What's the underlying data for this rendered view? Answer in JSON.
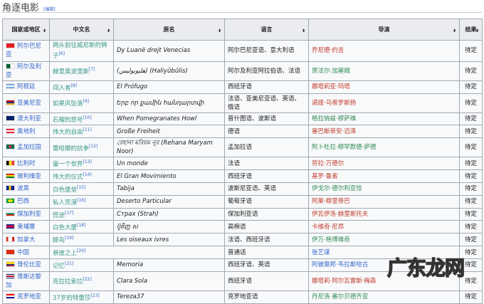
{
  "section": {
    "title": "角逐电影",
    "edit": "[编辑]"
  },
  "columns": [
    "国家或地区",
    "中文名",
    "原名",
    "语言",
    "导演",
    "结果"
  ],
  "rows": [
    {
      "country": "阿尔巴尼亚",
      "flag": "#e41e20",
      "cn": "两头前往威尼斯的狮子",
      "ref": "[6]",
      "orig": "Dy Luanë drejt Venecias",
      "lang": "阿尔巴尼亚语、意大利语",
      "dir": "乔尼德·约吉",
      "dc": "r",
      "result": "待定"
    },
    {
      "country": "阿尔及利亚",
      "flag": "linear-gradient(90deg,#006233 50%,#fff 50%)",
      "cn": "赫里奥波里斯",
      "ref": "[7]",
      "orig": "(هليوبوليس) (Haliyûbûlis)",
      "lang": "阿尔及利亚阿拉伯语、法语",
      "dir": "贾法尔·加塞姆",
      "dc": "g",
      "result": "待定"
    },
    {
      "country": "阿根廷",
      "flag": "linear-gradient(#74acdf 33%,#fff 33% 66%,#74acdf 66%)",
      "cn": "闯入者",
      "ref": "[8]",
      "orig": "El Prófugo",
      "lang": "西班牙语",
      "dir": "娜塔莉亚·玛塔",
      "dc": "r",
      "result": "待定"
    },
    {
      "country": "亚美尼亚",
      "flag": "linear-gradient(#d90012 33%,#0033a0 33% 66%,#f2a800 66%)",
      "cn": "如果风坠落",
      "ref": "[9]",
      "orig": "Երբ որ քամին հանդարտվի",
      "lang": "法语、亚美尼亚语、英语、俄语",
      "dir": "诺娅·马蒂罗斯扬",
      "dc": "r",
      "result": "待定"
    },
    {
      "country": "澳大利亚",
      "flag": "#012169",
      "cn": "石榴的怒号",
      "ref": "[10]",
      "orig": "When Pomegranates Howl",
      "lang": "普什图语、波斯语",
      "dir": "格拉纳兹·穆萨维",
      "dc": "g",
      "result": "待定"
    },
    {
      "country": "奥地利",
      "flag": "linear-gradient(#ed2939 33%,#fff 33% 66%,#ed2939 66%)",
      "cn": "伟大的自由",
      "ref": "[11]",
      "orig": "Große Freiheit",
      "lang": "德语",
      "dir": "塞巴斯蒂安·迈泽",
      "dc": "r",
      "result": "待定"
    },
    {
      "country": "孟加拉国",
      "flag": "radial-gradient(circle at 45% 50%,#f42a41 28%,#006a4e 30%)",
      "cn": "蕾哈娜的抗争",
      "ref": "[12]",
      "orig": "রেহানা মরিয়ম নূর (Rehana Maryam Noor)",
      "lang": "孟加拉语",
      "dir": "阿卜杜拉·穆罕默德·萨德",
      "dc": "g",
      "result": "待定"
    },
    {
      "country": "比利时",
      "flag": "linear-gradient(90deg,#000 33%,#fdda24 33% 66%,#ef3340 66%)",
      "cn": "童一个世界",
      "ref": "[13]",
      "orig": "Un monde",
      "lang": "法语",
      "dir": "劳拉·万德尔",
      "dc": "r",
      "result": "待定"
    },
    {
      "country": "玻利维亚",
      "flag": "linear-gradient(#d52b1e 33%,#f9e300 33% 66%,#007934 66%)",
      "cn": "伟大的仪式",
      "ref": "[14]",
      "orig": "El Gran Movimiento",
      "lang": "西班牙语",
      "dir": "基罗·鲁索",
      "dc": "r",
      "result": "待定"
    },
    {
      "country": "波黑",
      "flag": "linear-gradient(90deg,#002395 30%,#fecb00 30% 60%,#002395 60%)",
      "cn": "白色堡垒",
      "ref": "[15]",
      "orig": "Tabija",
      "lang": "波斯尼亚语、英语",
      "dir": "伊戈尔·德尔利亚恰",
      "dc": "g",
      "result": "待定"
    },
    {
      "country": "巴西",
      "flag": "radial-gradient(ellipse,#fedf00 45%,#009c3b 47%)",
      "cn": "私人荒漠",
      "ref": "[16]",
      "orig": "Deserto Particular",
      "lang": "葡萄牙语",
      "dir": "阿莱·穆里蒂巴",
      "dc": "r",
      "result": "待定"
    },
    {
      "country": "保加利亚",
      "flag": "linear-gradient(#fff 33%,#00966e 33% 66%,#d62612 66%)",
      "cn": "慌途",
      "ref": "[17]",
      "orig": "Страх (Strah)",
      "lang": "保加利亚语",
      "dir": "伊瓦伊洛·赫里斯托夫",
      "dc": "r",
      "result": "待定"
    },
    {
      "country": "柬埔寨",
      "flag": "linear-gradient(#032ea1 25%,#e00025 25% 75%,#032ea1 75%)",
      "cn": "白色大厦",
      "ref": "[18]",
      "orig": "ប៊ូតិញ ស",
      "lang": "高棉语",
      "dir": "卡维奇·尼昂",
      "dc": "r",
      "result": "待定"
    },
    {
      "country": "加拿大",
      "flag": "linear-gradient(90deg,#d52b1e 25%,#fff 25% 75%,#d52b1e 75%)",
      "cn": "醉鸟",
      "ref": "[19]",
      "orig": "Les oiseaux ivres",
      "lang": "法语、西班牙语",
      "dir": "伊万·格博维奇",
      "dc": "g",
      "result": "待定"
    },
    {
      "country": "中国",
      "flag": "#de2910",
      "cn": "悬崖之上",
      "ref": "[20]",
      "orig": "",
      "merged": true,
      "lang": "普通话",
      "dir": "张艺谋",
      "dc": "b",
      "result": "待定"
    },
    {
      "country": "哥伦比亚",
      "flag": "linear-gradient(#fcd116 50%,#003893 50% 75%,#ce1126 75%)",
      "cn": "记忆",
      "ref": "[21]",
      "orig": "Memoria",
      "lang": "西班牙语、英语",
      "dir": "阿彼察邦·韦拉斯哈古",
      "dc": "b",
      "result": "待定"
    },
    {
      "country": "哥斯达黎加",
      "flag": "linear-gradient(#002b7f 17%,#fff 17% 33%,#ce1126 33% 67%,#fff 67% 83%,#002b7f 83%)",
      "cn": "克拉拉索拉",
      "ref": "[22]",
      "orig": "Clara Sola",
      "lang": "西班牙语",
      "dir": "娜塔莉·阿尔瓦雷斯·梅森",
      "dc": "r",
      "result": "待定"
    },
    {
      "country": "克罗地亚",
      "flag": "linear-gradient(#ff0000 33%,#fff 33% 66%,#171796 66%)",
      "cn": "37岁的特蕾莎",
      "ref": "[23]",
      "orig": "Tereza37",
      "lang": "克罗地亚语",
      "dir": "丹尼洛·塞尔贝德齐亚",
      "dc": "g",
      "result": "待定"
    }
  ],
  "watermark": "广东龙网"
}
